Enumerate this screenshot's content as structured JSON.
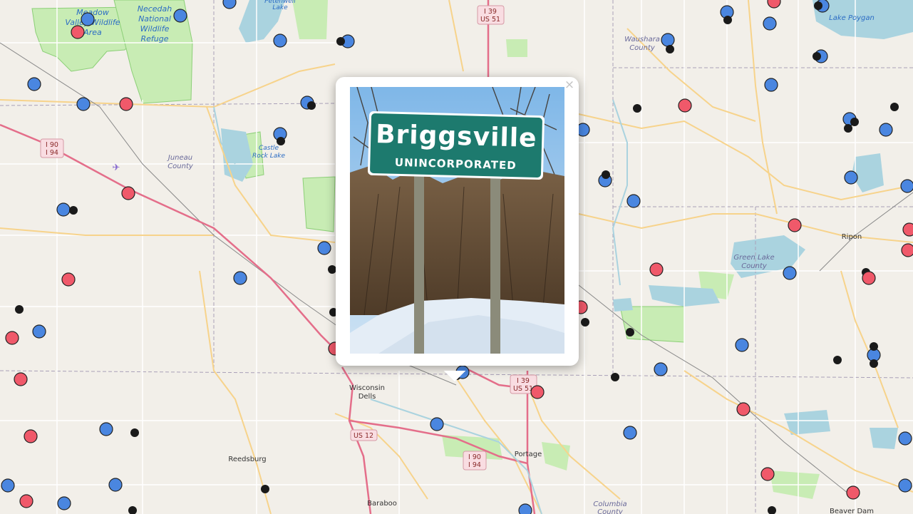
{
  "map": {
    "place_labels": [
      {
        "id": "wisconsin-dells",
        "text": "Wisconsin\nDells"
      },
      {
        "id": "reedsburg",
        "text": "Reedsburg"
      },
      {
        "id": "portage",
        "text": "Portage"
      },
      {
        "id": "baraboo",
        "text": "Baraboo"
      },
      {
        "id": "ripon",
        "text": "Ripon"
      },
      {
        "id": "beaver-dam",
        "text": "Beaver Dam"
      }
    ],
    "water_labels": [
      {
        "id": "meadow-valley",
        "text": "Meadow\nValley Wildlife\nArea"
      },
      {
        "id": "necedah",
        "text": "Necedah\nNational\nWildlife\nRefuge"
      },
      {
        "id": "castle-rock",
        "text": "Castle\nRock Lake"
      },
      {
        "id": "petenwell",
        "text": "Petenwell\nLake"
      },
      {
        "id": "lake-poygan",
        "text": "Lake Poygan"
      }
    ],
    "county_labels": [
      {
        "id": "juneau",
        "text": "Juneau\nCounty"
      },
      {
        "id": "waushara",
        "text": "Waushara\nCounty"
      },
      {
        "id": "green-lake",
        "text": "Green Lake\nCounty"
      },
      {
        "id": "columbia",
        "text": "Columbia\nCounty"
      }
    ],
    "route_shields": [
      {
        "id": "i39-north",
        "lines": [
          "I 39",
          "US 51"
        ]
      },
      {
        "id": "i90-west",
        "lines": [
          "I 90",
          "I 94"
        ]
      },
      {
        "id": "i39-south",
        "lines": [
          "I 39",
          "US 51"
        ]
      },
      {
        "id": "us12",
        "lines": [
          "US 12"
        ]
      },
      {
        "id": "i90-portage",
        "lines": [
          "I 90",
          "I 94"
        ]
      }
    ],
    "marker_colors": {
      "blue": "#4a86e0",
      "red": "#f0596a",
      "black": "#1a1a1a"
    }
  },
  "popup": {
    "close_label": "×",
    "photo": {
      "sign_title": "Briggsville",
      "sign_subtitle": "UNINCORPORATED"
    }
  }
}
